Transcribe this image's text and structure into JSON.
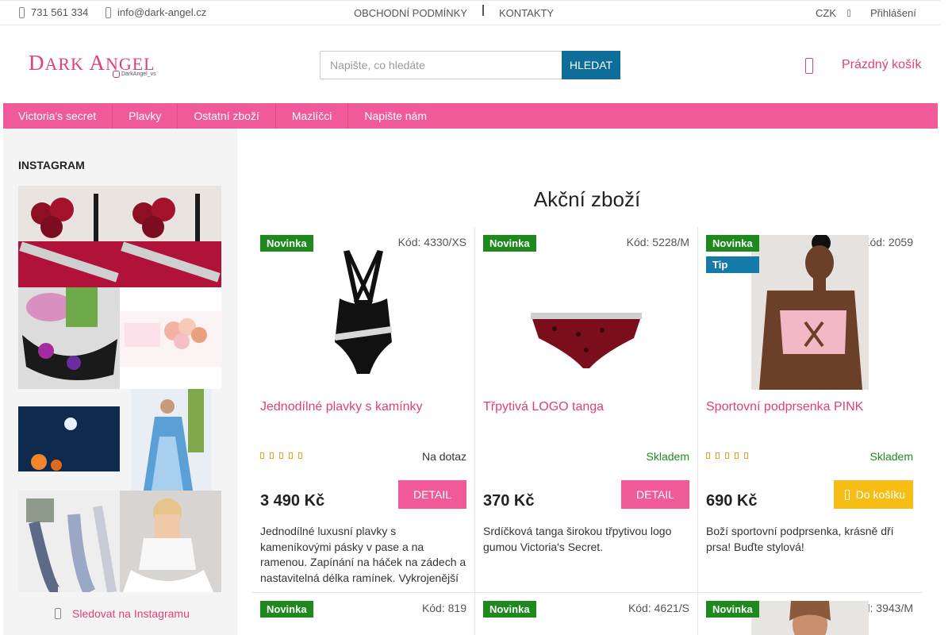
{
  "topbar": {
    "phone": "731 561 334",
    "email": "info@dark-angel.cz",
    "links": [
      "OBCHODNÍ PODMÍNKY",
      "KONTAKTY"
    ],
    "currency": "CZK",
    "login": "Přihlášení"
  },
  "header": {
    "logo_text_1": "D",
    "logo_text_2": "ARK ",
    "logo_text_3": "A",
    "logo_text_4": "NGEL",
    "logo_handle": "DarkAngel_vs",
    "search_placeholder": "Napište, co hledáte",
    "search_button": "HLEDAT",
    "cart_label": "Prázdný košík"
  },
  "menu": [
    "Victoria's secret",
    "Plavky",
    "Ostatní zboží",
    "Mazlíčci",
    "Napište nám"
  ],
  "sidebar": {
    "title": "INSTAGRAM",
    "follow_label": "Sledovat na Instagramu"
  },
  "main": {
    "title": "Akční zboží"
  },
  "products": [
    {
      "badges": [
        "Novinka"
      ],
      "code": "Kód: 4330/XS",
      "name": "Jednodílné plavky s kamínky",
      "availability": "Na dotaz",
      "availability_color": "#333333",
      "price": "3 490 Kč",
      "button": "DETAIL",
      "description": "Jednodílné luxusní plavky s kameníkovými pásky v pase a na ramenou. Zapínání na háček na zádech a nastavitelná délka ramínek. Vykrojenější",
      "stars": true
    },
    {
      "badges": [
        "Novinka"
      ],
      "code": "Kód: 5228/M",
      "name": "Třpytivá LOGO tanga",
      "availability": "Skladem",
      "availability_color": "#1e8a1e",
      "price": "370 Kč",
      "button": "DETAIL",
      "description": "Srdíčková tanga širokou třpytivou logo gumou Victoria's Secret.",
      "stars": false
    },
    {
      "badges": [
        "Novinka",
        "Tip"
      ],
      "code": "Kód: 2059",
      "name": "Sportovní podprsenka PINK",
      "availability": "Skladem",
      "availability_color": "#1e8a1e",
      "price": "690 Kč",
      "button": "Do košíku",
      "description": "Boží sportovní podprsenka, krásně dří prsa! Buďte stylová!",
      "stars": true
    }
  ],
  "products_row2": [
    {
      "badge": "Novinka",
      "code": "Kód: 819"
    },
    {
      "badge": "Novinka",
      "code": "Kód: 4621/S"
    },
    {
      "badge": "Novinka",
      "code": "Kód: 3943/M"
    }
  ],
  "colors": {
    "brand_pink": "#f05a99",
    "link_pink": "#e0407a",
    "search_blue": "#0f6d9a",
    "novinka_green": "#1e8a1e",
    "tip_blue": "#167aa8",
    "cart_yellow": "#f7bd14"
  }
}
